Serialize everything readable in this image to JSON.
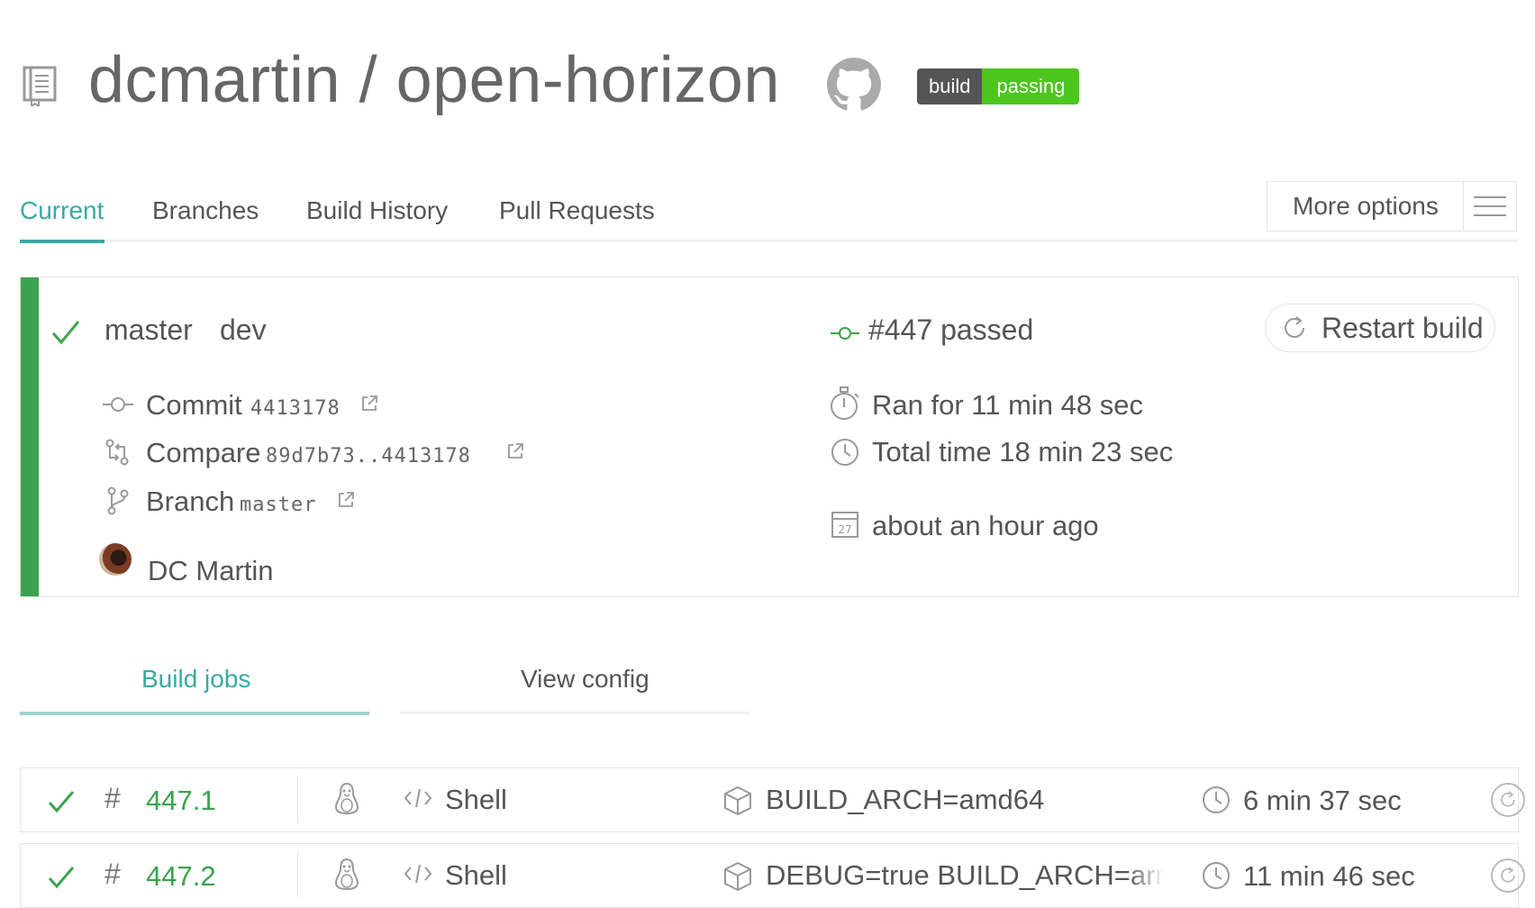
{
  "header": {
    "repo_title": "dcmartin / open-horizon",
    "badge_left": "build",
    "badge_right": "passing"
  },
  "tabs": [
    {
      "label": "Current",
      "active": true
    },
    {
      "label": "Branches"
    },
    {
      "label": "Build History"
    },
    {
      "label": "Pull Requests"
    }
  ],
  "more_options": {
    "label": "More options"
  },
  "build": {
    "branch": "master",
    "tag": "dev",
    "number_status": "#447 passed",
    "commit_label": "Commit",
    "commit_sha": "4413178",
    "compare_label": "Compare",
    "compare_range": "89d7b73..4413178",
    "branch_label": "Branch",
    "branch_name": "master",
    "author": "DC Martin",
    "ran_for": "Ran for 11 min 48 sec",
    "total_time": "Total time 18 min 23 sec",
    "calendar_day": "27",
    "when": "about an hour ago",
    "restart_label": "Restart build"
  },
  "subtabs": [
    {
      "label": "Build jobs",
      "active": true
    },
    {
      "label": "View config"
    }
  ],
  "jobs": [
    {
      "number": "447.1",
      "language": "Shell",
      "env": "BUILD_ARCH=amd64",
      "duration": "6 min 37 sec"
    },
    {
      "number": "447.2",
      "language": "Shell",
      "env": "DEBUG=true BUILD_ARCH=arm",
      "duration": "11 min 46 sec"
    }
  ],
  "colors": {
    "passed": "#3ba34d",
    "accent": "#39aaa4",
    "badge_green": "#4cc61e",
    "badge_dark": "#555555"
  }
}
